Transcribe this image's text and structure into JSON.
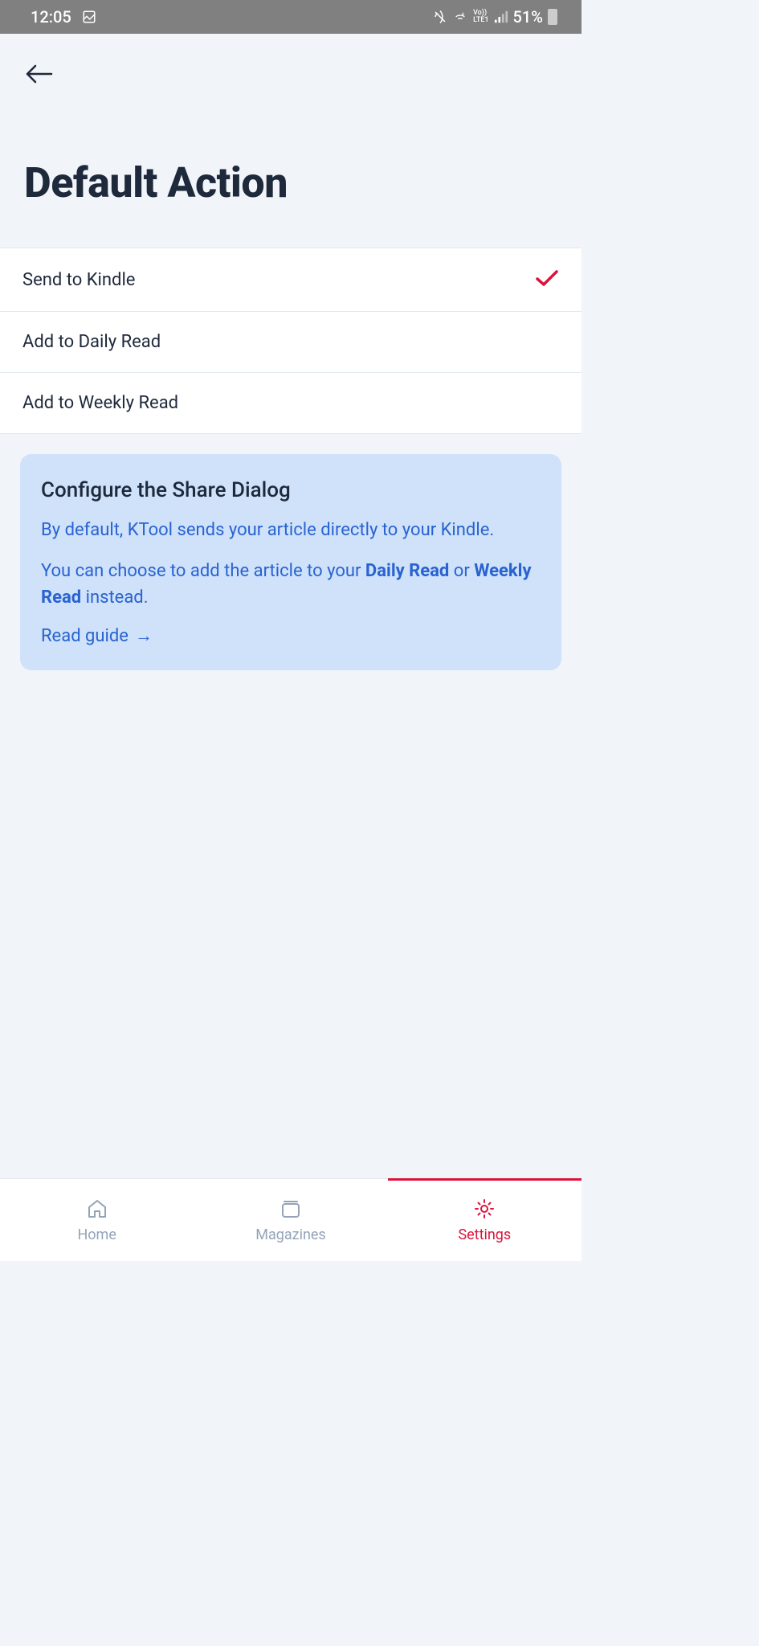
{
  "status_bar": {
    "time": "12:05",
    "battery": "51%",
    "network": "Vo)) LTE1"
  },
  "header": {
    "title": "Default Action"
  },
  "options": [
    {
      "label": "Send to Kindle",
      "selected": true
    },
    {
      "label": "Add to Daily Read",
      "selected": false
    },
    {
      "label": "Add to Weekly Read",
      "selected": false
    }
  ],
  "info_card": {
    "title": "Configure the Share Dialog",
    "text1": "By default, KTool sends your article directly to your Kindle.",
    "text2_prefix": "You can choose to add the article to your ",
    "text2_bold1": "Daily Read",
    "text2_mid": " or ",
    "text2_bold2": "Weekly Read",
    "text2_suffix": " instead.",
    "link_text": "Read guide",
    "link_arrow": "→"
  },
  "bottom_nav": [
    {
      "label": "Home",
      "active": false
    },
    {
      "label": "Magazines",
      "active": false
    },
    {
      "label": "Settings",
      "active": true
    }
  ]
}
